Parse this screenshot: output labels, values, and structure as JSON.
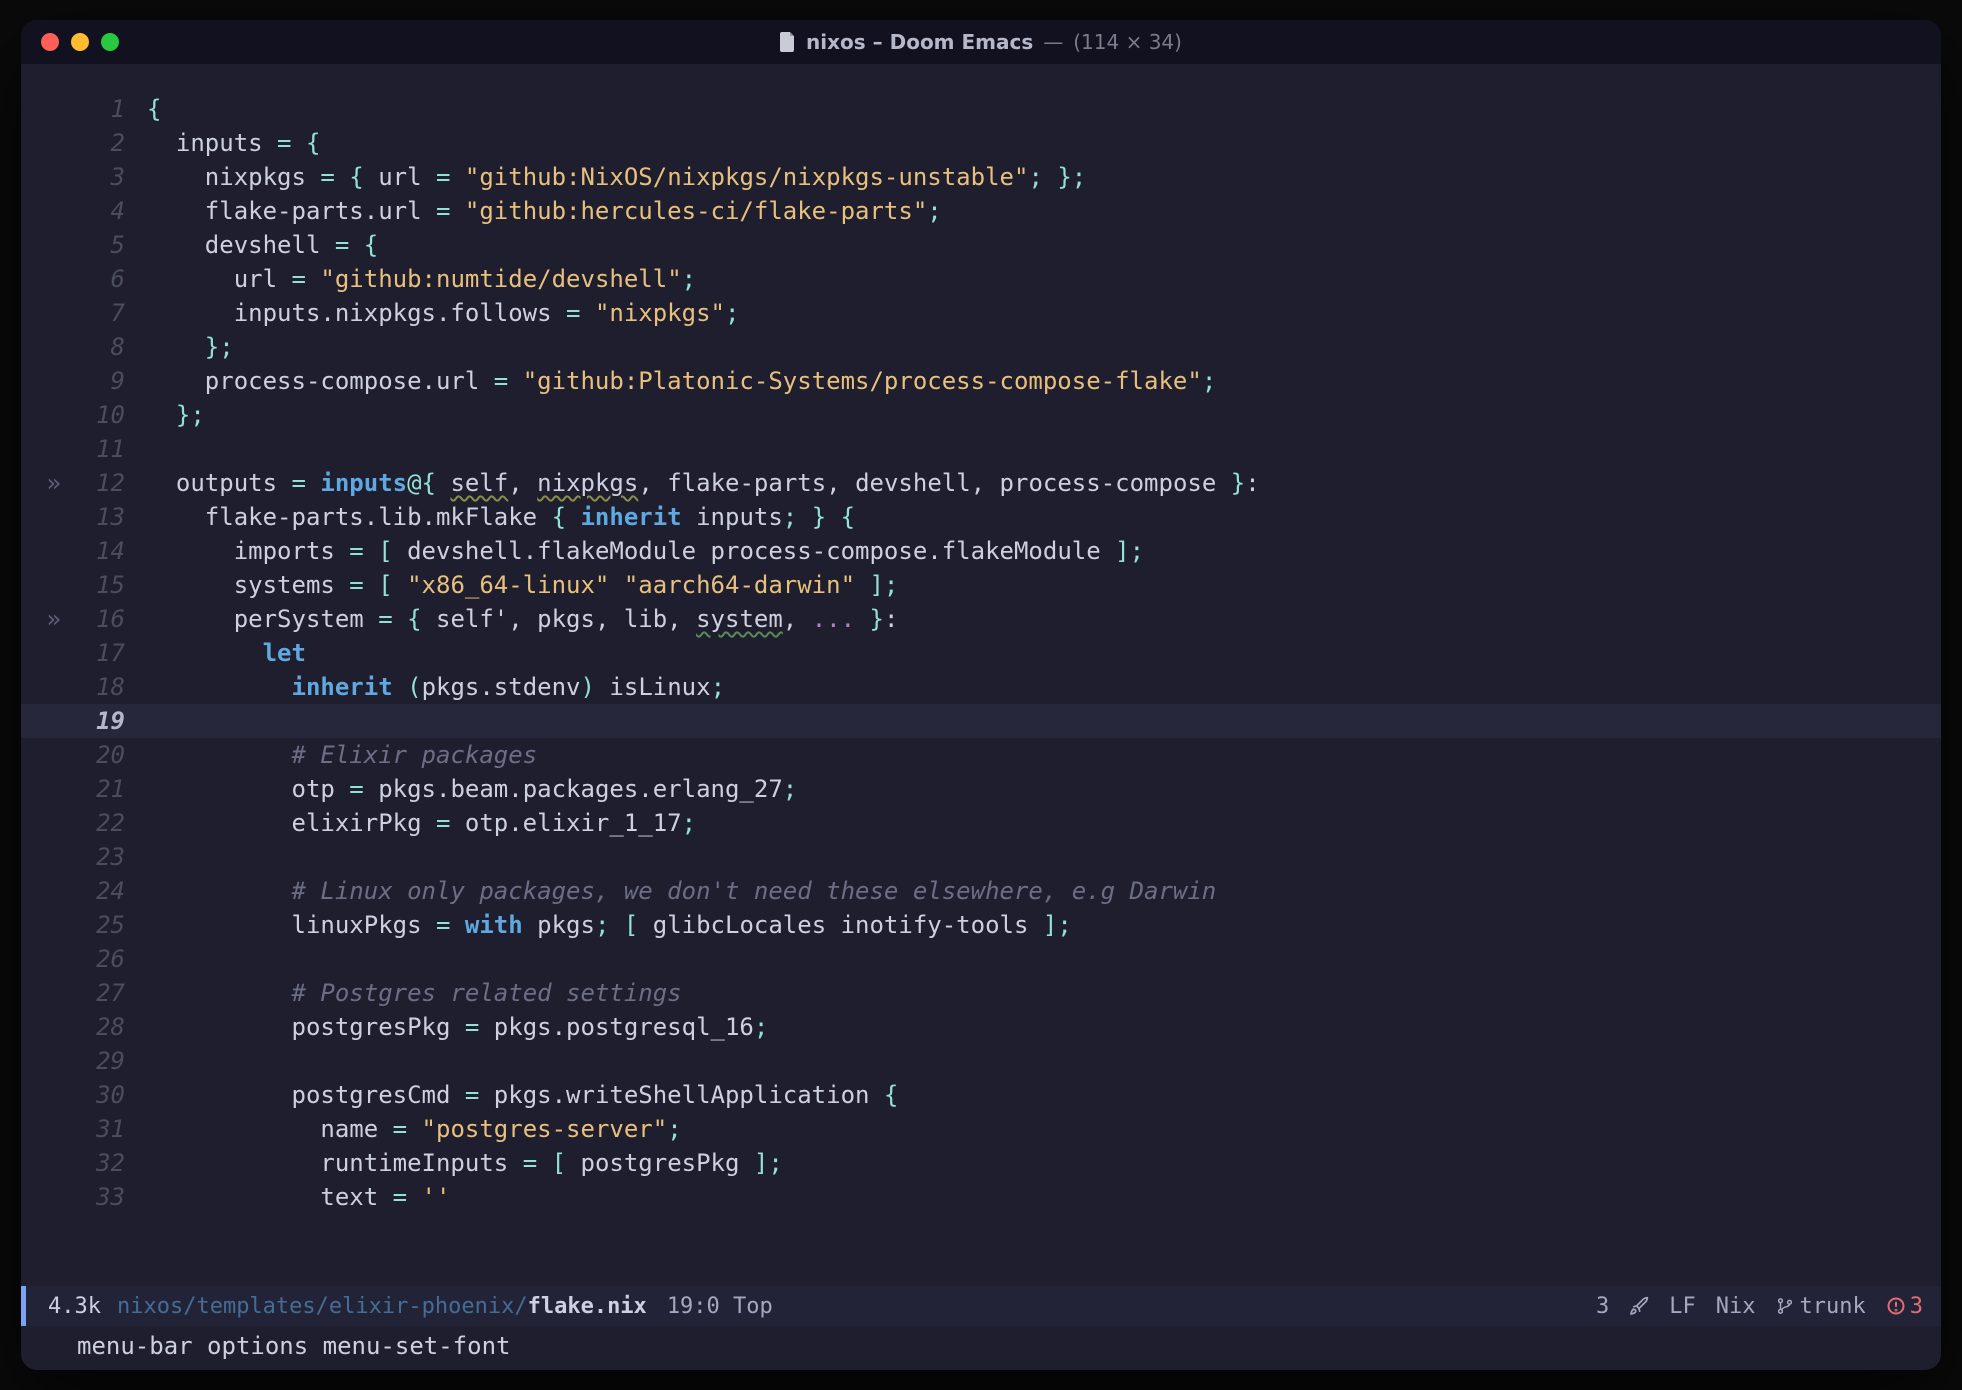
{
  "window": {
    "title_main": "nixos – Doom Emacs",
    "title_sep": "—",
    "title_dims": "(114 × 34)"
  },
  "gutter_marks": {
    "12": "»",
    "16": "»"
  },
  "current_line": 19,
  "code": {
    "1": [
      [
        "op",
        "{"
      ]
    ],
    "2": [
      [
        "fg",
        "  inputs "
      ],
      [
        "op",
        "= {"
      ]
    ],
    "3": [
      [
        "fg",
        "    nixpkgs "
      ],
      [
        "op",
        "= {"
      ],
      [
        "fg",
        " url "
      ],
      [
        "op",
        "= "
      ],
      [
        "str",
        "\"github:NixOS/nixpkgs/nixpkgs-unstable\""
      ],
      [
        "op",
        "; };"
      ]
    ],
    "4": [
      [
        "fg",
        "    flake-parts.url "
      ],
      [
        "op",
        "= "
      ],
      [
        "str",
        "\"github:hercules-ci/flake-parts\""
      ],
      [
        "op",
        ";"
      ]
    ],
    "5": [
      [
        "fg",
        "    devshell "
      ],
      [
        "op",
        "= {"
      ]
    ],
    "6": [
      [
        "fg",
        "      url "
      ],
      [
        "op",
        "= "
      ],
      [
        "str",
        "\"github:numtide/devshell\""
      ],
      [
        "op",
        ";"
      ]
    ],
    "7": [
      [
        "fg",
        "      inputs.nixpkgs.follows "
      ],
      [
        "op",
        "= "
      ],
      [
        "str",
        "\"nixpkgs\""
      ],
      [
        "op",
        ";"
      ]
    ],
    "8": [
      [
        "fg",
        "    "
      ],
      [
        "op",
        "};"
      ]
    ],
    "9": [
      [
        "fg",
        "    process-compose.url "
      ],
      [
        "op",
        "= "
      ],
      [
        "str",
        "\"github:Platonic-Systems/process-compose-flake\""
      ],
      [
        "op",
        ";"
      ]
    ],
    "10": [
      [
        "fg",
        "  "
      ],
      [
        "op",
        "};"
      ]
    ],
    "11": [
      [
        "fg",
        ""
      ]
    ],
    "12": [
      [
        "fg",
        "  outputs "
      ],
      [
        "op",
        "= "
      ],
      [
        "kw2",
        "inputs"
      ],
      [
        "op",
        "@{ "
      ],
      [
        "warn",
        "self"
      ],
      [
        "fg",
        ", "
      ],
      [
        "warn",
        "nixpkgs"
      ],
      [
        "fg",
        ", flake-parts, devshell, process-compose "
      ],
      [
        "op",
        "}"
      ],
      [
        "fg",
        ":"
      ]
    ],
    "13": [
      [
        "fg",
        "    flake-parts.lib.mkFlake "
      ],
      [
        "op",
        "{ "
      ],
      [
        "kw",
        "inherit"
      ],
      [
        "fg",
        " inputs"
      ],
      [
        "op",
        "; } {"
      ]
    ],
    "14": [
      [
        "fg",
        "      imports "
      ],
      [
        "op",
        "= ["
      ],
      [
        "fg",
        " devshell.flakeModule process-compose.flakeModule "
      ],
      [
        "op",
        "];"
      ]
    ],
    "15": [
      [
        "fg",
        "      systems "
      ],
      [
        "op",
        "= [ "
      ],
      [
        "str",
        "\"x86_64-linux\""
      ],
      [
        "fg",
        " "
      ],
      [
        "str",
        "\"aarch64-darwin\""
      ],
      [
        "op",
        " ];"
      ]
    ],
    "16": [
      [
        "fg",
        "      perSystem "
      ],
      [
        "op",
        "= {"
      ],
      [
        "fg",
        " self', pkgs, lib, "
      ],
      [
        "warn2",
        "system"
      ],
      [
        "fg",
        ", "
      ],
      [
        "dots",
        "..."
      ],
      [
        "fg",
        " "
      ],
      [
        "op",
        "}"
      ],
      [
        "fg",
        ":"
      ]
    ],
    "17": [
      [
        "fg",
        "        "
      ],
      [
        "kw",
        "let"
      ]
    ],
    "18": [
      [
        "fg",
        "          "
      ],
      [
        "kw",
        "inherit"
      ],
      [
        "fg",
        " "
      ],
      [
        "op",
        "("
      ],
      [
        "fg",
        "pkgs.stdenv"
      ],
      [
        "op",
        ")"
      ],
      [
        "fg",
        " isLinux"
      ],
      [
        "op",
        ";"
      ]
    ],
    "19": [
      [
        "fg",
        ""
      ]
    ],
    "20": [
      [
        "fg",
        "          "
      ],
      [
        "comment",
        "# Elixir packages"
      ]
    ],
    "21": [
      [
        "fg",
        "          otp "
      ],
      [
        "op",
        "="
      ],
      [
        "fg",
        " pkgs.beam.packages.erlang_27"
      ],
      [
        "op",
        ";"
      ]
    ],
    "22": [
      [
        "fg",
        "          elixirPkg "
      ],
      [
        "op",
        "="
      ],
      [
        "fg",
        " otp.elixir_1_17"
      ],
      [
        "op",
        ";"
      ]
    ],
    "23": [
      [
        "fg",
        ""
      ]
    ],
    "24": [
      [
        "fg",
        "          "
      ],
      [
        "comment",
        "# Linux only packages, we don't need these elsewhere, e.g Darwin"
      ]
    ],
    "25": [
      [
        "fg",
        "          linuxPkgs "
      ],
      [
        "op",
        "= "
      ],
      [
        "kw",
        "with"
      ],
      [
        "fg",
        " pkgs"
      ],
      [
        "op",
        "; ["
      ],
      [
        "fg",
        " glibcLocales inotify-tools "
      ],
      [
        "op",
        "];"
      ]
    ],
    "26": [
      [
        "fg",
        ""
      ]
    ],
    "27": [
      [
        "fg",
        "          "
      ],
      [
        "comment",
        "# Postgres related settings"
      ]
    ],
    "28": [
      [
        "fg",
        "          postgresPkg "
      ],
      [
        "op",
        "="
      ],
      [
        "fg",
        " pkgs.postgresql_16"
      ],
      [
        "op",
        ";"
      ]
    ],
    "29": [
      [
        "fg",
        ""
      ]
    ],
    "30": [
      [
        "fg",
        "          postgresCmd "
      ],
      [
        "op",
        "="
      ],
      [
        "fg",
        " pkgs.writeShellApplication "
      ],
      [
        "op",
        "{"
      ]
    ],
    "31": [
      [
        "fg",
        "            name "
      ],
      [
        "op",
        "= "
      ],
      [
        "str",
        "\"postgres-server\""
      ],
      [
        "op",
        ";"
      ]
    ],
    "32": [
      [
        "fg",
        "            runtimeInputs "
      ],
      [
        "op",
        "= ["
      ],
      [
        "fg",
        " postgresPkg "
      ],
      [
        "op",
        "];"
      ]
    ],
    "33": [
      [
        "fg",
        "            text "
      ],
      [
        "op",
        "= "
      ],
      [
        "str",
        "''"
      ],
      [
        "fg",
        ""
      ]
    ]
  },
  "modeline": {
    "size": "4.3k",
    "path_dim": "nixos/templates/elixir-phoenix/",
    "path_file": "flake.nix",
    "position": "19:0 Top",
    "right": {
      "checker_count": "3",
      "encoding": "LF",
      "mode": "Nix",
      "branch": "trunk",
      "errors": "3"
    }
  },
  "minibuffer": "menu-bar options menu-set-font"
}
